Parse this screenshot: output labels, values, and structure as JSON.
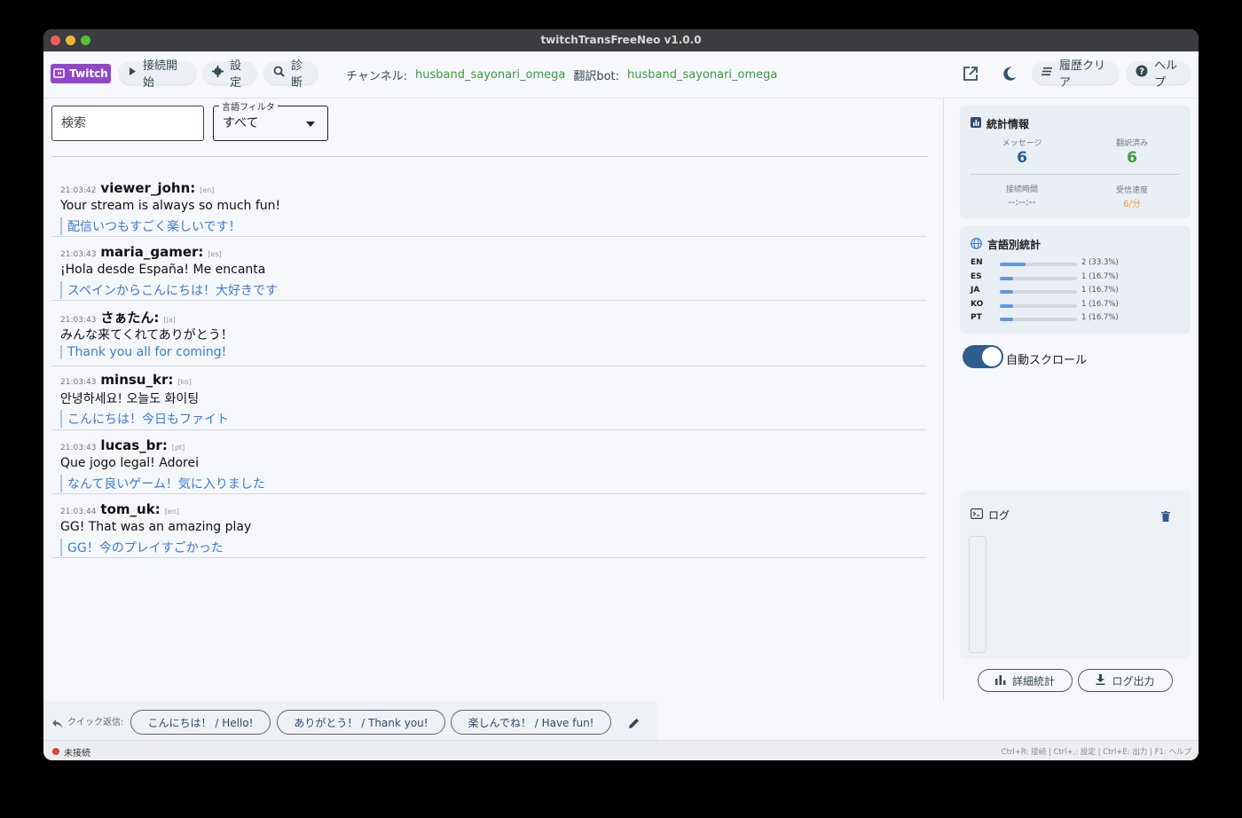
{
  "window": {
    "title": "twitchTransFreeNeo v1.0.0"
  },
  "toolbar": {
    "twitch_label": "Twitch",
    "connect_label": "接続開始",
    "settings_label": "設定",
    "diagnose_label": "診断",
    "channel_label": "チャンネル:",
    "channel_value": "husband_sayonari_omega",
    "bot_label": "翻訳bot:",
    "bot_value": "husband_sayonari_omega",
    "clear_history_label": "履歴クリア",
    "help_label": "ヘルプ"
  },
  "filters": {
    "search_placeholder": "検索",
    "language_filter_label": "言語フィルタ",
    "language_filter_value": "すべて"
  },
  "messages": [
    {
      "time": "21:03:42",
      "user": "viewer_john:",
      "lang": "[en]",
      "original": "Your stream is always so much fun!",
      "translation": "配信いつもすごく楽しいです！"
    },
    {
      "time": "21:03:43",
      "user": "maria_gamer:",
      "lang": "[es]",
      "original": "¡Hola desde España! Me encanta",
      "translation": "スペインからこんにちは！大好きです"
    },
    {
      "time": "21:03:43",
      "user": "さぁたん:",
      "lang": "[ja]",
      "original": "みんな来てくれてありがとう！",
      "translation": "Thank you all for coming!"
    },
    {
      "time": "21:03:43",
      "user": "minsu_kr:",
      "lang": "[ko]",
      "original": "안녕하세요! 오늘도 화이팅",
      "translation": "こんにちは！今日もファイト"
    },
    {
      "time": "21:03:43",
      "user": "lucas_br:",
      "lang": "[pt]",
      "original": "Que jogo legal! Adorei",
      "translation": "なんて良いゲーム！気に入りました"
    },
    {
      "time": "21:03:44",
      "user": "tom_uk:",
      "lang": "[en]",
      "original": "GG! That was an amazing play",
      "translation": "GG！今のプレイすごかった"
    }
  ],
  "stats": {
    "title": "統計情報",
    "messages_label": "メッセージ",
    "messages_value": "6",
    "translated_label": "翻訳済み",
    "translated_value": "6",
    "uptime_label": "接続時間",
    "uptime_value": "--:--:--",
    "rate_label": "受信速度",
    "rate_value": "6/分"
  },
  "language_stats": {
    "title": "言語別統計",
    "rows": [
      {
        "code": "EN",
        "fraction": 0.333,
        "text": "2 (33.3%)"
      },
      {
        "code": "ES",
        "fraction": 0.167,
        "text": "1 (16.7%)"
      },
      {
        "code": "JA",
        "fraction": 0.167,
        "text": "1 (16.7%)"
      },
      {
        "code": "KO",
        "fraction": 0.167,
        "text": "1 (16.7%)"
      },
      {
        "code": "PT",
        "fraction": 0.167,
        "text": "1 (16.7%)"
      }
    ]
  },
  "autoscroll": {
    "label": "自動スクロール",
    "enabled": true
  },
  "log": {
    "title": "ログ"
  },
  "actions": {
    "detail_stats_label": "詳細統計",
    "export_log_label": "ログ出力"
  },
  "quick_reply": {
    "label": "クイック返信:",
    "buttons": [
      "こんにちは！ / Hello!",
      "ありがとう！ / Thank you!",
      "楽しんでね！ / Have fun!"
    ]
  },
  "status": {
    "connection": "未接続",
    "shortcuts": "Ctrl+R: 接続 | Ctrl+,: 設定 | Ctrl+E: 出力 | F1: ヘルプ"
  },
  "colors": {
    "accent_twitch": "#9146c9",
    "channel_green": "#3c9a3c",
    "translation_blue": "#3a7bd5",
    "rate_orange": "#f0a030",
    "disconnected_red": "#e0443a"
  }
}
